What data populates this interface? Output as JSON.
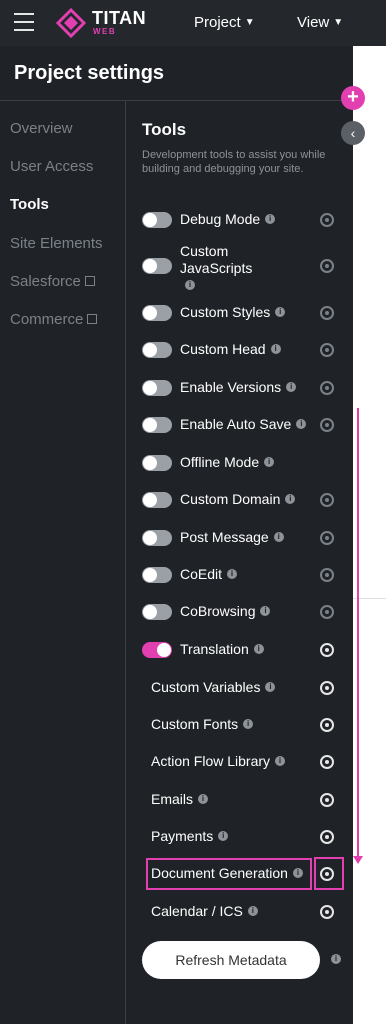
{
  "header": {
    "brand": "TITAN",
    "brand_sub": "WEB",
    "menus": [
      {
        "label": "Project"
      },
      {
        "label": "View"
      }
    ]
  },
  "panel": {
    "title": "Project settings"
  },
  "side_nav": [
    {
      "label": "Overview",
      "active": false,
      "external": false
    },
    {
      "label": "User Access",
      "active": false,
      "external": false
    },
    {
      "label": "Tools",
      "active": true,
      "external": false
    },
    {
      "label": "Site Elements",
      "active": false,
      "external": false
    },
    {
      "label": "Salesforce",
      "active": false,
      "external": true
    },
    {
      "label": "Commerce",
      "active": false,
      "external": true
    }
  ],
  "tools": {
    "title": "Tools",
    "description": "Development tools to assist you while building and debugging your site.",
    "items": [
      {
        "label": "Debug Mode",
        "toggle": "off"
      },
      {
        "label": "Custom JavaScripts",
        "toggle": "off"
      },
      {
        "label": "Custom Styles",
        "toggle": "off"
      },
      {
        "label": "Custom Head",
        "toggle": "off"
      },
      {
        "label": "Enable Versions",
        "toggle": "off"
      },
      {
        "label": "Enable Auto Save",
        "toggle": "off"
      },
      {
        "label": "Offline Mode",
        "toggle": "off"
      },
      {
        "label": "Custom Domain",
        "toggle": "off"
      },
      {
        "label": "Post Message",
        "toggle": "off"
      },
      {
        "label": "CoEdit",
        "toggle": "off"
      },
      {
        "label": "CoBrowsing",
        "toggle": "off"
      },
      {
        "label": "Translation",
        "toggle": "on"
      },
      {
        "label": "Custom Variables",
        "toggle": "none"
      },
      {
        "label": "Custom Fonts",
        "toggle": "none"
      },
      {
        "label": "Action Flow Library",
        "toggle": "none"
      },
      {
        "label": "Emails",
        "toggle": "none"
      },
      {
        "label": "Payments",
        "toggle": "none"
      },
      {
        "label": "Document Generation",
        "toggle": "none",
        "highlighted": true
      },
      {
        "label": "Calendar / ICS",
        "toggle": "none"
      }
    ],
    "refresh_button": "Refresh Metadata",
    "info_glyph": "i"
  },
  "floating": {
    "plus": "+",
    "collapse": "‹"
  },
  "colors": {
    "accent": "#e23fb1",
    "panel_bg": "#1f2327",
    "topbar_bg": "#24282c"
  }
}
